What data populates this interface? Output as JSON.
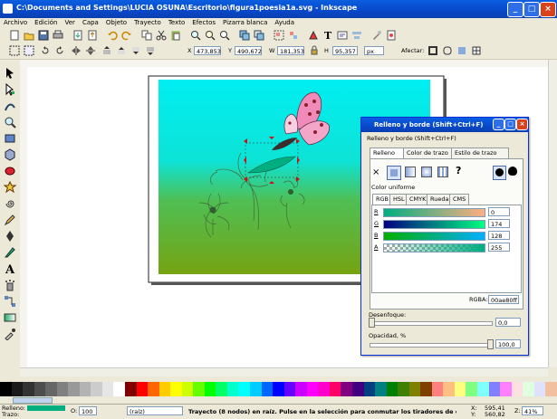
{
  "window": {
    "title": "C:\\Documents and Settings\\LUCIA OSUNA\\Escritorio\\figura1poesia1a.svg - Inkscape"
  },
  "menu": [
    "Archivo",
    "Edición",
    "Ver",
    "Capa",
    "Objeto",
    "Trayecto",
    "Texto",
    "Efectos",
    "Pizarra blanca",
    "Ayuda"
  ],
  "selector_bar": {
    "x_label": "X",
    "x_value": "473,853",
    "y_label": "Y",
    "y_value": "490,672",
    "w_label": "W",
    "w_value": "181,353",
    "h_label": "H",
    "h_value": "95,357",
    "unit": "px",
    "affect_label": "Afectar:"
  },
  "dialog": {
    "title": "Relleno y borde (Shift+Ctrl+F)",
    "subtitle": "Relleno y borde (Shift+Ctrl+F)",
    "tabs": [
      "Relleno",
      "Color de trazo",
      "Estilo de trazo"
    ],
    "section": "Color uniforme",
    "mode_tabs": [
      "RGB",
      "HSL",
      "CMYK",
      "Rueda",
      "CMS"
    ],
    "channels": [
      {
        "label": "R",
        "value": "0"
      },
      {
        "label": "G",
        "value": "174"
      },
      {
        "label": "B",
        "value": "128"
      },
      {
        "label": "A",
        "value": "255"
      }
    ],
    "rgba_label": "RGBA:",
    "rgba_value": "00ae80ff",
    "blur_label": "Desenfoque:",
    "blur_value": "0,0",
    "opacity_label": "Opacidad, %",
    "opacity_value": "100,0"
  },
  "status": {
    "fill_label": "Relleno:",
    "stroke_label": "Trazo:",
    "opacity_label": "O:",
    "opacity_value": "100",
    "layer": "(raíz)",
    "message": "Trayecto (8 nodos) en raíz. Pulse en la selección para conmutar los tiradores de escalado/rotación.",
    "x_label": "X:",
    "x_value": "595,41",
    "y_label": "Y:",
    "y_value": "560,82",
    "zoom_label": "Z:",
    "zoom_value": "41%"
  },
  "colors": {
    "fill": "#00ae80",
    "title_blue": "#0848c8",
    "sky": "#00e5ee",
    "grass": "#76a312"
  },
  "palette": [
    "#000000",
    "#1a1a1a",
    "#333333",
    "#4d4d4d",
    "#666666",
    "#808080",
    "#999999",
    "#b3b3b3",
    "#cccccc",
    "#e6e6e6",
    "#ffffff",
    "#800000",
    "#ff0000",
    "#ff6600",
    "#ffcc00",
    "#ffff00",
    "#ccff00",
    "#66ff00",
    "#00ff00",
    "#00ff66",
    "#00ffcc",
    "#00ffff",
    "#00ccff",
    "#0066ff",
    "#0000ff",
    "#6600ff",
    "#cc00ff",
    "#ff00ff",
    "#ff00cc",
    "#ff0066",
    "#800080",
    "#400080",
    "#004080",
    "#008080",
    "#008000",
    "#408000",
    "#808000",
    "#804000",
    "#ff8080",
    "#ffbf80",
    "#ffff80",
    "#80ff80",
    "#80ffff",
    "#8080ff",
    "#ff80ff",
    "#ffe0e0",
    "#e0ffe0",
    "#e0e0ff",
    "#f0c0a0"
  ]
}
